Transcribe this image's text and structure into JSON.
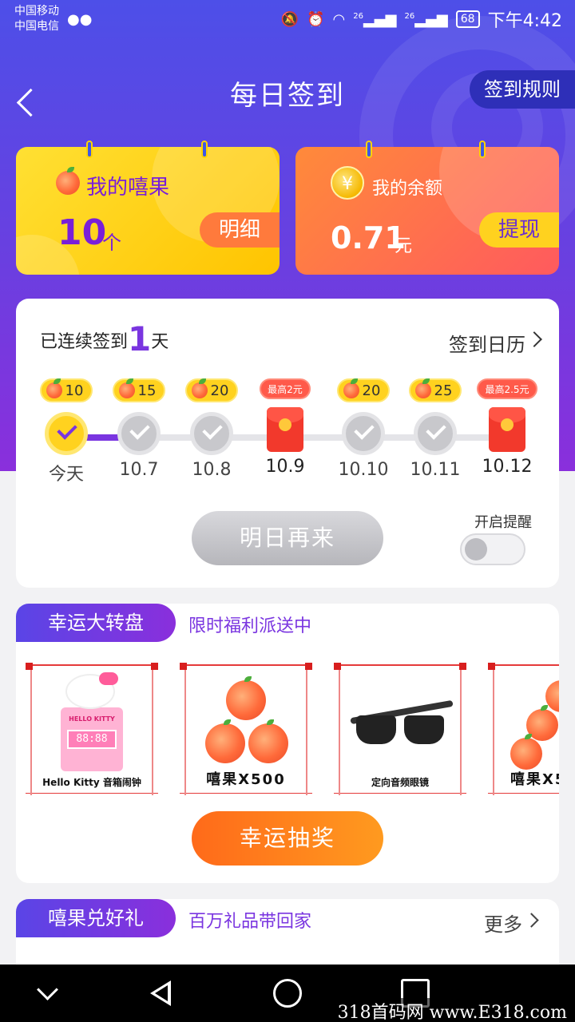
{
  "status_bar": {
    "carrier_1": "中国移动",
    "carrier_2": "中国电信",
    "network_1": "26",
    "network_2": "26",
    "battery": "68",
    "time": "下午4:42"
  },
  "header": {
    "title": "每日签到",
    "rules_button": "签到规则"
  },
  "fruit_card": {
    "label": "我的嘻果",
    "value": "10",
    "unit": "个",
    "action": "明细"
  },
  "balance_card": {
    "label": "我的余额",
    "coin_symbol": "¥",
    "value": "0.71",
    "unit": "元",
    "action": "提现"
  },
  "checkin": {
    "streak_prefix": "已连续签到",
    "streak_days": "1",
    "streak_suffix": "天",
    "calendar_link": "签到日历",
    "days": [
      {
        "reward": "10",
        "label": "今天",
        "state": "today"
      },
      {
        "reward": "15",
        "label": "10.7",
        "state": "pending"
      },
      {
        "reward": "20",
        "label": "10.8",
        "state": "pending"
      },
      {
        "reward": "最高2元",
        "label": "10.9",
        "state": "redpack"
      },
      {
        "reward": "20",
        "label": "10.10",
        "state": "pending"
      },
      {
        "reward": "25",
        "label": "10.11",
        "state": "pending"
      },
      {
        "reward": "最高2.5元",
        "label": "10.12",
        "state": "redpack"
      }
    ],
    "tomorrow_button": "明日再来",
    "reminder_label": "开启提醒",
    "reminder_on": false
  },
  "lucky_wheel": {
    "tag": "幸运大转盘",
    "subtitle": "限时福利派送中",
    "prizes": [
      {
        "name": "Hello Kitty 音箱闹钟",
        "icon": "hello-kitty-clock-image",
        "clock_text": "88:88",
        "kitty_text": "HELLO KITTY"
      },
      {
        "name": "嘻果X500",
        "icon": "peaches-image"
      },
      {
        "name": "定向音频眼镜",
        "icon": "sunglasses-image"
      },
      {
        "name": "嘻果X5",
        "icon": "peaches-image"
      }
    ],
    "draw_button": "幸运抽奖"
  },
  "gifts": {
    "tag": "嘻果兑好礼",
    "subtitle": "百万礼品带回家",
    "more": "更多"
  },
  "watermark": "318首码网 www.E318.com",
  "colors": {
    "accent_purple": "#7a35e0",
    "hero_blue": "#4d4fe8",
    "yellow": "#ffd21f",
    "orange": "#ff7a3c"
  }
}
